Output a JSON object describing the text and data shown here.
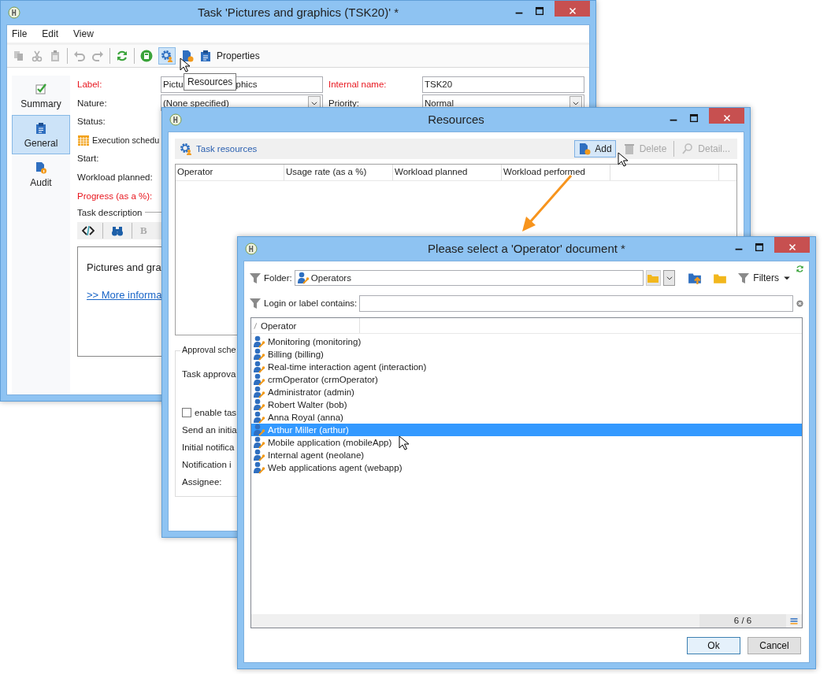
{
  "task_window": {
    "title": "Task 'Pictures and graphics (TSK20)' *",
    "menu": [
      "File",
      "Edit",
      "View"
    ],
    "properties_label": "Properties",
    "tooltip": "Resources",
    "sidebar": [
      {
        "label": "Summary",
        "selected": false
      },
      {
        "label": "General",
        "selected": true
      },
      {
        "label": "Audit",
        "selected": false
      }
    ],
    "label_field": {
      "label": "Label:",
      "required": true,
      "value_start": "Pictu",
      "value_end": "phics"
    },
    "internal_name": {
      "label": "Internal name:",
      "required": true,
      "value": "TSK20"
    },
    "nature": {
      "label": "Nature:",
      "required": false,
      "value": "(None specified)"
    },
    "priority": {
      "label": "Priority:",
      "required": false,
      "value": "Normal"
    },
    "rows": [
      {
        "kind": "label",
        "label": "Status:",
        "required": false
      },
      {
        "kind": "schedule",
        "label": "Execution schedu",
        "required": false
      },
      {
        "kind": "label",
        "label": "Start:",
        "required": false
      },
      {
        "kind": "label",
        "label": "Workload planned:",
        "required": false
      },
      {
        "kind": "label",
        "label": "Progress (as a %):",
        "required": true
      }
    ],
    "description": {
      "legend": "Task description",
      "format_button": "B",
      "text": "Pictures and gra",
      "link": ">> More informa"
    }
  },
  "resources_window": {
    "title": "Resources",
    "section": "Task resources",
    "actions": [
      {
        "kind": "add",
        "label": "Add",
        "disabled": false,
        "highlighted": true
      },
      {
        "kind": "delete",
        "label": "Delete",
        "disabled": true,
        "highlighted": false
      },
      {
        "kind": "detail",
        "label": "Detail...",
        "disabled": true,
        "highlighted": false
      }
    ],
    "columns": [
      "Operator",
      "Usage rate (as a %)",
      "Workload planned",
      "Workload performed"
    ],
    "approval": {
      "legend": "Approval sche",
      "rows": [
        {
          "kind": "text",
          "label": "Task approva"
        },
        {
          "kind": "checkbox",
          "label": "enable tas",
          "checked": false
        },
        {
          "kind": "text",
          "label": "Send an initia"
        },
        {
          "kind": "text",
          "label": "Initial notifica"
        },
        {
          "kind": "text",
          "label": "Notification i"
        },
        {
          "kind": "text",
          "label": "Assignee:"
        }
      ]
    }
  },
  "select_dialog": {
    "title": "Please select a 'Operator' document *",
    "folder_label": "Folder:",
    "folder": "Operators",
    "filters": "Filters",
    "search_label": "Login or label contains:",
    "column": "Operator",
    "operators": [
      {
        "label": "Monitoring (monitoring)",
        "selected": false
      },
      {
        "label": "Billing (billing)",
        "selected": false
      },
      {
        "label": "Real-time interaction agent (interaction)",
        "selected": false
      },
      {
        "label": "crmOperator (crmOperator)",
        "selected": false
      },
      {
        "label": "Administrator (admin)",
        "selected": false
      },
      {
        "label": "Robert Walter (bob)",
        "selected": false
      },
      {
        "label": "Anna Royal (anna)",
        "selected": false
      },
      {
        "label": "Arthur Miller (arthur)",
        "selected": true
      },
      {
        "label": "Mobile application (mobileApp)",
        "selected": false
      },
      {
        "label": "Internal agent (neolane)",
        "selected": false
      },
      {
        "label": "Web applications agent (webapp)",
        "selected": false
      }
    ],
    "count": "6 / 6",
    "buttons": [
      {
        "label": "Ok",
        "default": true
      },
      {
        "label": "Cancel",
        "default": false
      }
    ]
  }
}
